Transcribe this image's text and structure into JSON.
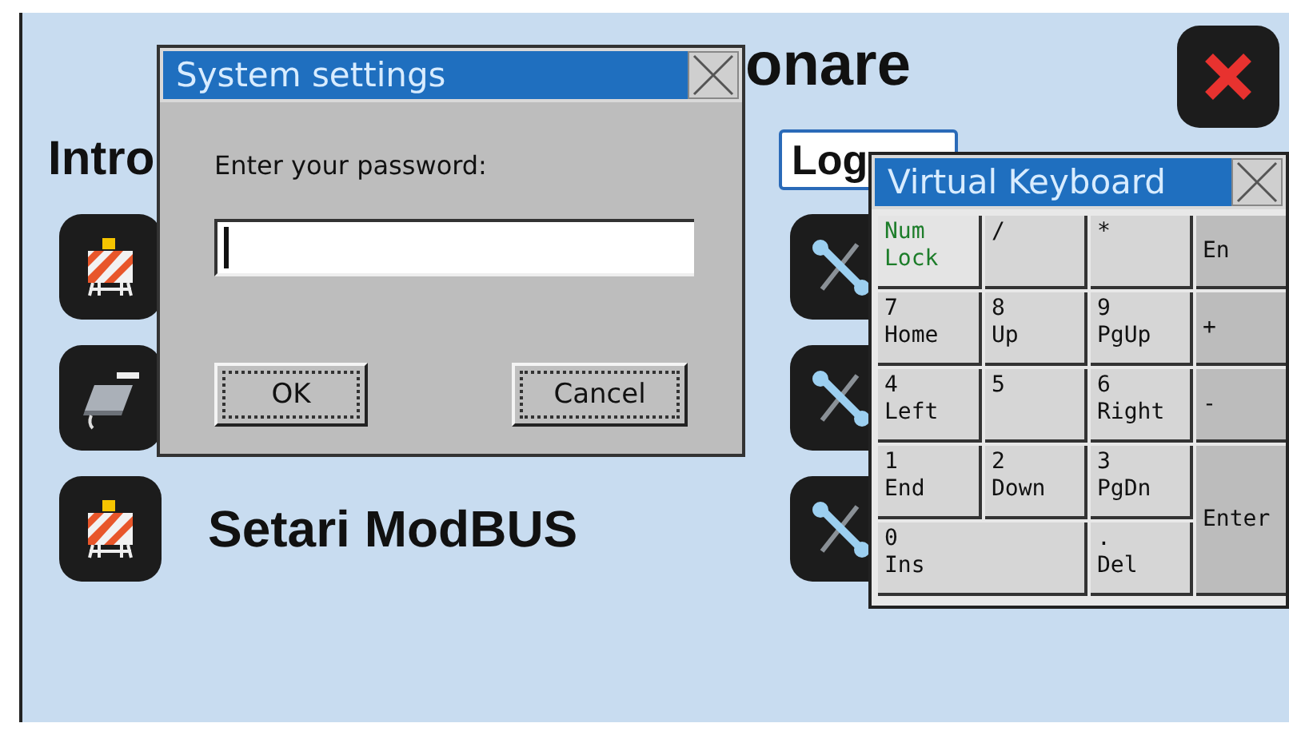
{
  "screen": {
    "title": "onare",
    "section": "Intro",
    "logout_button": "Log"
  },
  "items": [
    {
      "kind": "barrier"
    },
    {
      "kind": "device"
    },
    {
      "kind": "barrier",
      "label": "Setari ModBUS"
    }
  ],
  "dialog": {
    "title": "System settings",
    "prompt": "Enter your password:",
    "buttons": [
      "OK",
      "Cancel"
    ]
  },
  "keyboard": {
    "title": "Virtual Keyboard",
    "keys": [
      {
        "label": "Num\nLock",
        "kind": "toggle"
      },
      {
        "label": "/",
        "kind": "key"
      },
      {
        "label": "*",
        "kind": "key"
      },
      {
        "label": "En",
        "kind": "side"
      },
      {
        "label": "7\nHome",
        "kind": "key"
      },
      {
        "label": "8\nUp",
        "kind": "key"
      },
      {
        "label": "9\nPgUp",
        "kind": "key"
      },
      {
        "label": "+",
        "kind": "side"
      },
      {
        "label": "4\nLeft",
        "kind": "key"
      },
      {
        "label": "5",
        "kind": "key"
      },
      {
        "label": "6\nRight",
        "kind": "key"
      },
      {
        "label": "-",
        "kind": "side"
      },
      {
        "label": "1\nEnd",
        "kind": "key"
      },
      {
        "label": "2\nDown",
        "kind": "key"
      },
      {
        "label": "3\nPgDn",
        "kind": "key"
      },
      {
        "label": "Enter",
        "kind": "tall"
      },
      {
        "label": "0\nIns",
        "kind": "wide"
      },
      {
        "label": ".\nDel",
        "kind": "key"
      }
    ]
  }
}
